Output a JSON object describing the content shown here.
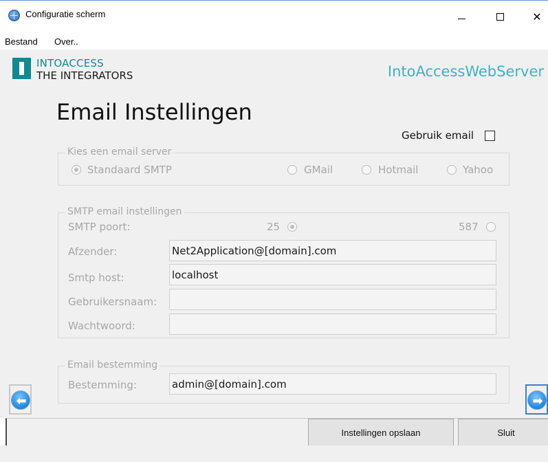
{
  "window": {
    "title": "Configuratie scherm",
    "icon": "globe-icon",
    "controls": {
      "minimize": "minimize-icon",
      "maximize": "maximize-icon",
      "close_symbol": "✕"
    }
  },
  "menu": {
    "items": [
      "Bestand",
      "Over.."
    ]
  },
  "header": {
    "logo_top": "INTOACCESS",
    "logo_bottom": "THE INTEGRATORS",
    "app_name": "IntoAccessWebServer"
  },
  "page": {
    "title": "Email Instellingen",
    "use_email_label": "Gebruik email",
    "use_email_checked": false
  },
  "server_group": {
    "legend": "Kies een email server",
    "options": [
      {
        "label": "Standaard SMTP",
        "checked": true
      },
      {
        "label": "GMail",
        "checked": false
      },
      {
        "label": "Hotmail",
        "checked": false
      },
      {
        "label": "Yahoo",
        "checked": false
      }
    ]
  },
  "smtp_group": {
    "legend": "SMTP email instellingen",
    "port_label": "SMTP poort:",
    "port_options": [
      {
        "label": "25",
        "checked": true
      },
      {
        "label": "587",
        "checked": false
      }
    ],
    "fields": [
      {
        "label": "Afzender:",
        "value": "Net2Application@[domain].com"
      },
      {
        "label": "Smtp host:",
        "value": "localhost"
      },
      {
        "label": "Gebruikersnaam:",
        "value": ""
      },
      {
        "label": "Wachtwoord:",
        "value": ""
      }
    ]
  },
  "destination_group": {
    "legend": "Email bestemming",
    "label": "Bestemming:",
    "value": "admin@[domain].com"
  },
  "nav": {
    "back_icon": "arrow-left-icon",
    "forward_icon": "arrow-right-icon",
    "back_glyph": "⬅",
    "forward_glyph": "➡"
  },
  "footer": {
    "save_label": "Instellingen opslaan",
    "close_label": "Sluit"
  },
  "colors": {
    "accent_teal": "#0e8a92",
    "app_name": "#3eb3c4",
    "disabled_text": "#a7a7a7",
    "focus_blue": "#3b7ed6"
  }
}
